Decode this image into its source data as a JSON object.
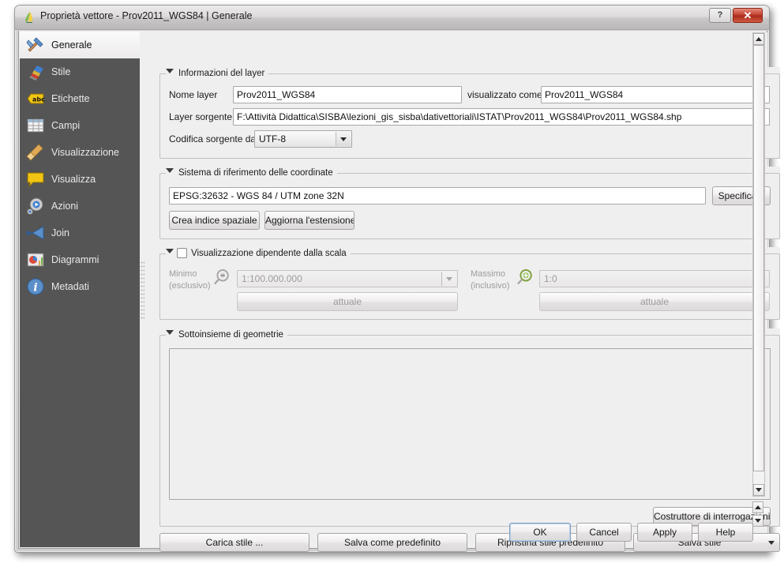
{
  "window": {
    "title": "Proprietà vettore - Prov2011_WGS84 | Generale",
    "icon": "qgis-layer-icon",
    "help_button": "?",
    "close_button": "✕"
  },
  "sidebar": {
    "items": [
      {
        "label": "Generale",
        "icon": "tools-hammer-icon",
        "selected": true
      },
      {
        "label": "Stile",
        "icon": "paintbrush-icon",
        "selected": false
      },
      {
        "label": "Etichette",
        "icon": "abc-label-icon",
        "selected": false
      },
      {
        "label": "Campi",
        "icon": "table-fields-icon",
        "selected": false
      },
      {
        "label": "Visualizzazione",
        "icon": "broom-render-icon",
        "selected": false
      },
      {
        "label": "Visualizza",
        "icon": "speech-bubble-icon",
        "selected": false
      },
      {
        "label": "Azioni",
        "icon": "gear-play-icon",
        "selected": false
      },
      {
        "label": "Join",
        "icon": "join-arrow-icon",
        "selected": false
      },
      {
        "label": "Diagrammi",
        "icon": "diagram-chart-icon",
        "selected": false
      },
      {
        "label": "Metadati",
        "icon": "info-circle-icon",
        "selected": false
      }
    ]
  },
  "layer_info": {
    "group_title": "Informazioni del layer",
    "name_label": "Nome layer",
    "name_value": "Prov2011_WGS84",
    "displayed_as_label": "visualizzato come",
    "displayed_as_value": "Prov2011_WGS84",
    "source_label": "Layer sorgente",
    "source_value": "F:\\Attività Didattica\\SISBA\\lezioni_gis_sisba\\dativettoriali\\ISTAT\\Prov2011_WGS84\\Prov2011_WGS84.shp",
    "encoding_label": "Codifica sorgente dati",
    "encoding_value": "UTF-8"
  },
  "crs": {
    "group_title": "Sistema di riferimento delle coordinate",
    "value": "EPSG:32632 - WGS 84 / UTM zone 32N",
    "specify_button": "Specifica...",
    "create_index_button": "Crea indice spaziale",
    "update_extent_button": "Aggiorna l'estensione"
  },
  "scale_visibility": {
    "group_title": "Visualizzazione dipendente dalla scala",
    "enabled": false,
    "min_label_line1": "Minimo",
    "min_label_line2": "(esclusivo)",
    "min_icon": "magnifier-minus-icon",
    "min_value": "1:100.000.000",
    "min_current_button": "attuale",
    "max_label_line1": "Massimo",
    "max_label_line2": "(inclusivo)",
    "max_icon": "magnifier-plus-icon",
    "max_value": "1:0",
    "max_current_button": "attuale"
  },
  "geometry_subset": {
    "group_title": "Sottoinsieme di geometrie",
    "value": "",
    "query_builder_button": "Costruttore di interrogazioni"
  },
  "style_buttons": {
    "load_style": "Carica stile ...",
    "save_default": "Salva come predefinito",
    "restore_default": "Ripristina stile predefinito",
    "save_style": "Salva stile"
  },
  "dialog_buttons": {
    "ok": "OK",
    "cancel": "Cancel",
    "apply": "Apply",
    "help": "Help"
  },
  "colors": {
    "sidebar_bg": "#555555",
    "content_bg": "#f0efef",
    "close_button": "#c03a27",
    "disabled_text": "#9d9b9b"
  }
}
